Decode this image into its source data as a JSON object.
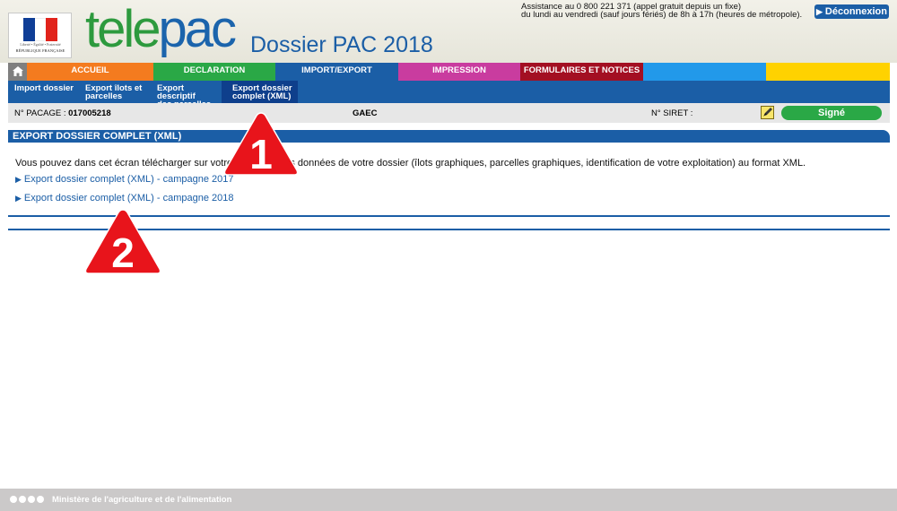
{
  "header": {
    "logo": {
      "motto": "Liberté • Égalité • Fraternité",
      "republic": "RÉPUBLIQUE FRANÇAISE",
      "flag_colors": [
        "#0f3e96",
        "#ffffff",
        "#e1231b"
      ]
    },
    "brand_tele": "tele",
    "brand_pac": "pac",
    "title": "Dossier PAC 2018",
    "assistance_line1": "Assistance au 0 800 221 371 (appel gratuit depuis un fixe)",
    "assistance_line2": "du lundi au vendredi (sauf jours fériés) de 8h à 17h (heures de métropole).",
    "logout_label": "Déconnexion"
  },
  "nav": {
    "tabs": [
      {
        "label": "",
        "color": "#7f7f7f",
        "icon": "home-icon"
      },
      {
        "label": "ACCUEIL",
        "color": "#f47b1f"
      },
      {
        "label": "DECLARATION",
        "color": "#2aa846"
      },
      {
        "label": "IMPORT/EXPORT",
        "color": "#1b5ea6"
      },
      {
        "label": "IMPRESSION",
        "color": "#c93c9f"
      },
      {
        "label": "FORMULAIRES ET NOTICES",
        "color": "#a30f22"
      },
      {
        "label": "",
        "color": "#2299ea"
      },
      {
        "label": "",
        "color": "#ffd200"
      }
    ]
  },
  "subnav": {
    "items": [
      {
        "line1": "Import dossier",
        "line2": ""
      },
      {
        "line1": "Export îlots et",
        "line2": "parcelles"
      },
      {
        "line1": "Export descriptif",
        "line2": "des parcelles"
      },
      {
        "line1": "Export dossier",
        "line2": "complet (XML)"
      }
    ]
  },
  "infobar": {
    "pacage_label": "N° PACAGE : ",
    "pacage_value": "017005218",
    "company": "GAEC",
    "siret_label": "N° SIRET :",
    "status": "Signé"
  },
  "main": {
    "section_title": "EXPORT DOSSIER COMPLET (XML)",
    "intro": "Vous pouvez dans cet écran télécharger sur votre ordinateur les données de votre dossier (îlots graphiques, parcelles graphiques, identification de votre exploitation) au format XML.",
    "links": [
      {
        "label": "Export dossier complet (XML) - campagne 2017"
      },
      {
        "label": "Export dossier complet (XML) - campagne 2018"
      }
    ]
  },
  "callouts": {
    "first": "1",
    "second": "2",
    "color": "#e8141b"
  },
  "footer": {
    "text": "Ministère de l'agriculture et de l'alimentation"
  }
}
